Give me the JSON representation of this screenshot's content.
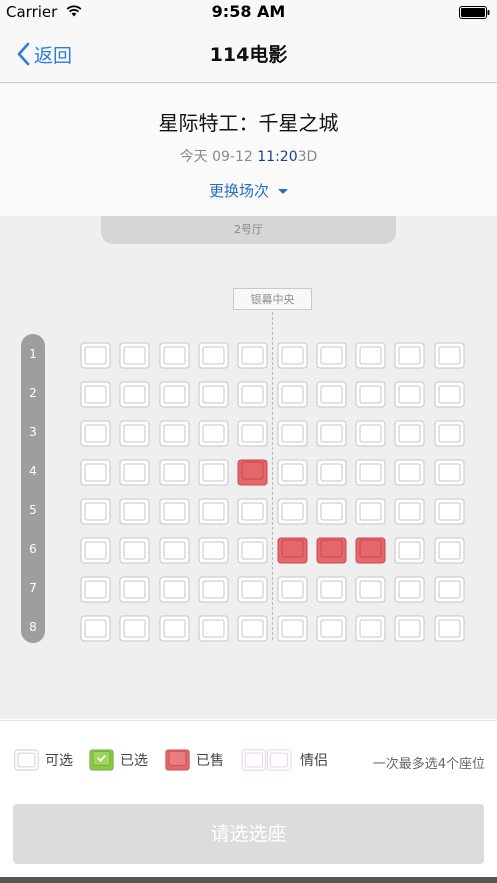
{
  "status_bar": {
    "carrier": "Carrier",
    "time": "9:58 AM"
  },
  "nav": {
    "back_label": "返回",
    "title": "114电影"
  },
  "movie": {
    "title": "星际特工：千星之城",
    "date_prefix": "今天 09-12",
    "time": "11:20",
    "format": "3D",
    "change_session": "更换场次"
  },
  "hall": {
    "name": "2号厅",
    "screen_label": "银幕中央"
  },
  "seat_map": {
    "row_labels": [
      "1",
      "2",
      "3",
      "4",
      "5",
      "6",
      "7",
      "8"
    ],
    "columns": 10,
    "sold_seats": [
      {
        "row": 4,
        "col": 5
      },
      {
        "row": 6,
        "col": 6
      },
      {
        "row": 6,
        "col": 7
      },
      {
        "row": 6,
        "col": 8
      }
    ],
    "colors": {
      "available_fill": "#ffffff",
      "available_stroke": "#c4c4c4",
      "sold_fill": "#e4686b",
      "sold_stroke": "#c8494c",
      "selected_fill": "#8bc84a",
      "couple_stroke": "#e5c9e6"
    }
  },
  "legend": {
    "available": "可选",
    "selected": "已选",
    "sold": "已售",
    "couple": "情侣",
    "note": "一次最多选4个座位"
  },
  "button": {
    "label": "请选选座"
  },
  "colors": {
    "accent": "#2b7de1",
    "time_highlight": "#1b3f8e"
  }
}
